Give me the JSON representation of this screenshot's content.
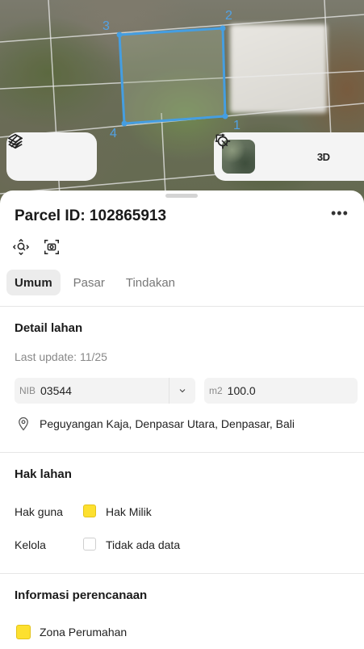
{
  "map": {
    "vertex_labels": [
      "1",
      "2",
      "3",
      "4"
    ],
    "controls": {
      "layers_icon": "layers-icon",
      "measure_icon": "measure-icon",
      "basemap_icon": "satellite-thumbnail",
      "locate_icon": "crosshair-icon",
      "view3d_label": "3D",
      "select_icon": "select-icon"
    },
    "parcel_color": "#3da0ea"
  },
  "sheet": {
    "title": "Parcel ID: 102865913",
    "more_label": "•••",
    "tools": [
      "zoom-parcel-icon",
      "screenshot-icon"
    ],
    "tabs": [
      {
        "label": "Umum",
        "active": true
      },
      {
        "label": "Pasar",
        "active": false
      },
      {
        "label": "Tindakan",
        "active": false
      }
    ],
    "detail": {
      "heading": "Detail lahan",
      "last_update": "Last update: 11/25",
      "nib_prefix": "NIB",
      "nib_value": "03544",
      "area_prefix": "m2",
      "area_value": "100.0",
      "address": "Peguyangan Kaja, Denpasar Utara, Denpasar, Bali"
    },
    "rights": {
      "heading": "Hak lahan",
      "rows": [
        {
          "label": "Hak guna",
          "value": "Hak Milik",
          "color": "#fde02f"
        },
        {
          "label": "Kelola",
          "value": "Tidak ada data",
          "color": "#ffffff"
        }
      ]
    },
    "planning": {
      "heading": "Informasi perencanaan",
      "zone": "Zona Perumahan",
      "zone_color": "#fde02f"
    }
  }
}
